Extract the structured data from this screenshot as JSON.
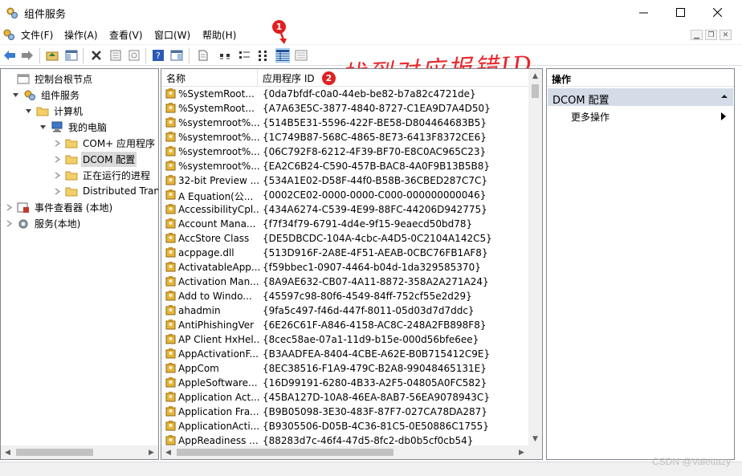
{
  "window": {
    "title": "组件服务"
  },
  "menu": [
    "文件(F)",
    "操作(A)",
    "查看(V)",
    "窗口(W)",
    "帮助(H)"
  ],
  "annotations": {
    "badge1": "1",
    "badge2": "2",
    "handwritten": "找到对应报错ID"
  },
  "tree": [
    {
      "label": "控制台根节点",
      "level": 0,
      "expander": "none",
      "icon": "console-root-icon"
    },
    {
      "label": "组件服务",
      "level": 1,
      "expander": "expanded",
      "icon": "component-services-icon"
    },
    {
      "label": "计算机",
      "level": 2,
      "expander": "expanded",
      "icon": "folder-icon"
    },
    {
      "label": "我的电脑",
      "level": 3,
      "expander": "expanded",
      "icon": "computer-icon"
    },
    {
      "label": "COM+ 应用程序",
      "level": 4,
      "expander": "collapsed",
      "icon": "folder-icon"
    },
    {
      "label": "DCOM 配置",
      "level": 4,
      "expander": "collapsed",
      "icon": "folder-icon",
      "selected": true
    },
    {
      "label": "正在运行的进程",
      "level": 4,
      "expander": "collapsed",
      "icon": "folder-icon"
    },
    {
      "label": "Distributed Transaction Coordinator",
      "level": 4,
      "expander": "collapsed",
      "icon": "folder-icon"
    },
    {
      "label": "事件查看器 (本地)",
      "level": 0,
      "expander": "collapsed",
      "icon": "event-viewer-icon"
    },
    {
      "label": "服务(本地)",
      "level": 0,
      "expander": "collapsed",
      "icon": "services-icon"
    }
  ],
  "list": {
    "columns": [
      "名称",
      "应用程序 ID"
    ],
    "rows": [
      {
        "name": "%SystemRoot...",
        "id": "{0da7bfdf-c0a0-44eb-be82-b7a82c4721de}"
      },
      {
        "name": "%SystemRoot...",
        "id": "{A7A63E5C-3877-4840-8727-C1EA9D7A4D50}"
      },
      {
        "name": "%systemroot%...",
        "id": "{514B5E31-5596-422F-BE58-D804464683B5}"
      },
      {
        "name": "%systemroot%...",
        "id": "{1C749B87-568C-4865-8E73-6413F8372CE6}"
      },
      {
        "name": "%systemroot%...",
        "id": "{06C792F8-6212-4F39-BF70-E8C0AC965C23}"
      },
      {
        "name": "%systemroot%...",
        "id": "{EA2C6B24-C590-457B-BAC8-4A0F9B13B5B8}"
      },
      {
        "name": "32-bit Preview ...",
        "id": "{534A1E02-D58F-44f0-B58B-36CBED287C7C}"
      },
      {
        "name": "A Equation(公...",
        "id": "{0002CE02-0000-0000-C000-000000000046}"
      },
      {
        "name": "AccessibilityCpl...",
        "id": "{434A6274-C539-4E99-88FC-44206D942775}"
      },
      {
        "name": "Account Mana...",
        "id": "{f7f34f79-6791-4d4e-9f15-9eaecd50bd78}"
      },
      {
        "name": "AccStore Class",
        "id": "{DE5DBCDC-104A-4cbc-A4D5-0C2104A142C5}"
      },
      {
        "name": "acppage.dll",
        "id": "{513D916F-2A8E-4F51-AEAB-0CBC76FB1AF8}"
      },
      {
        "name": "ActivatableApp...",
        "id": "{f59bbec1-0907-4464-b04d-1da329585370}"
      },
      {
        "name": "Activation Man...",
        "id": "{8A9AE632-CB07-4A11-8872-358A2A271A24}"
      },
      {
        "name": "Add to Windo...",
        "id": "{45597c98-80f6-4549-84ff-752cf55e2d29}"
      },
      {
        "name": "ahadmin",
        "id": "{9fa5c497-f46d-447f-8011-05d03d7d7ddc}"
      },
      {
        "name": "AntiPhishingVer",
        "id": "{6E26C61F-A846-4158-AC8C-248A2FB898F8}"
      },
      {
        "name": "AP Client HxHel...",
        "id": "{8cec58ae-07a1-11d9-b15e-000d56bfe6ee}"
      },
      {
        "name": "AppActivationF...",
        "id": "{B3AADFEA-8404-4CBE-A62E-B0B715412C9E}"
      },
      {
        "name": "AppCom",
        "id": "{8EC38516-F1A9-479C-B2A8-99048465131E}"
      },
      {
        "name": "AppleSoftware...",
        "id": "{16D99191-6280-4B33-A2F5-04805A0FC582}"
      },
      {
        "name": "Application Act...",
        "id": "{45BA127D-10A8-46EA-8AB7-56EA9078943C}"
      },
      {
        "name": "Application Fra...",
        "id": "{B9B05098-3E30-483F-87F7-027CA78DA287}"
      },
      {
        "name": "ApplicationActi...",
        "id": "{B9305506-D05B-4C36-81C5-0E50886C1755}"
      },
      {
        "name": "AppReadiness ...",
        "id": "{88283d7c-46f4-47d5-8fc2-db0b5cf0cb54}"
      }
    ]
  },
  "actions": {
    "header": "操作",
    "section": "DCOM 配置",
    "more": "更多操作"
  },
  "watermark": "CSDN @Valettazy"
}
